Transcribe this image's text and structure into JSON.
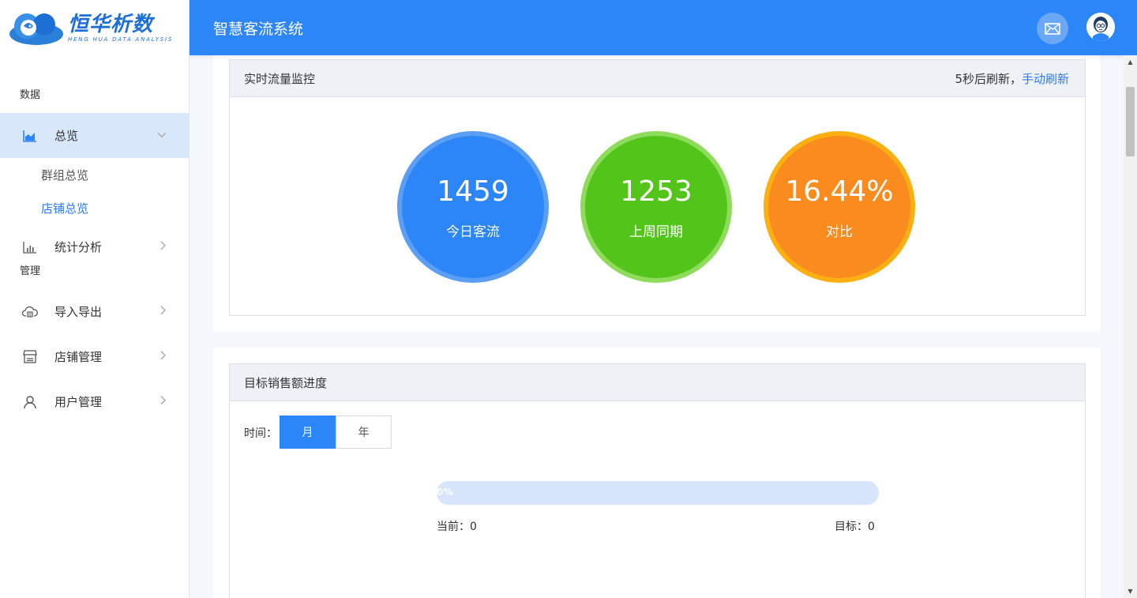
{
  "brand": {
    "name_cn": "恒华析数",
    "name_en": "HENG HUA DATA ANALYSIS"
  },
  "header": {
    "title": "智慧客流系统",
    "mail_icon": "mail-icon",
    "avatar_icon": "avatar-icon"
  },
  "sidebar": {
    "sections": {
      "data": "数据",
      "manage": "管理"
    },
    "items": {
      "overview": {
        "label": "总览",
        "icon": "area-chart-icon"
      },
      "group_overview": {
        "label": "群组总览"
      },
      "store_overview": {
        "label": "店铺总览"
      },
      "stats": {
        "label": "统计分析",
        "icon": "bar-chart-icon"
      },
      "import_export": {
        "label": "导入导出",
        "icon": "cloud-transfer-icon"
      },
      "store_manage": {
        "label": "店铺管理",
        "icon": "store-icon"
      },
      "user_manage": {
        "label": "用户管理",
        "icon": "user-icon"
      }
    }
  },
  "realtime": {
    "title": "实时流量监控",
    "refresh_text": "5秒后刷新，",
    "refresh_link": "手动刷新",
    "today": {
      "value": "1459",
      "label": "今日客流"
    },
    "last_week": {
      "value": "1253",
      "label": "上周同期"
    },
    "compare": {
      "value": "16.44%",
      "label": "对比"
    }
  },
  "sales_target": {
    "title": "目标销售额进度",
    "time_label": "时间：",
    "tab_month": "月",
    "tab_year": "年",
    "progress": 0,
    "progress_text": "0%",
    "current": "当前：0",
    "target": "目标：0"
  },
  "colors": {
    "primary": "#2d86f7",
    "green": "#52c41a",
    "orange": "#fa8c1f",
    "active_bg": "#d9e7fb"
  }
}
